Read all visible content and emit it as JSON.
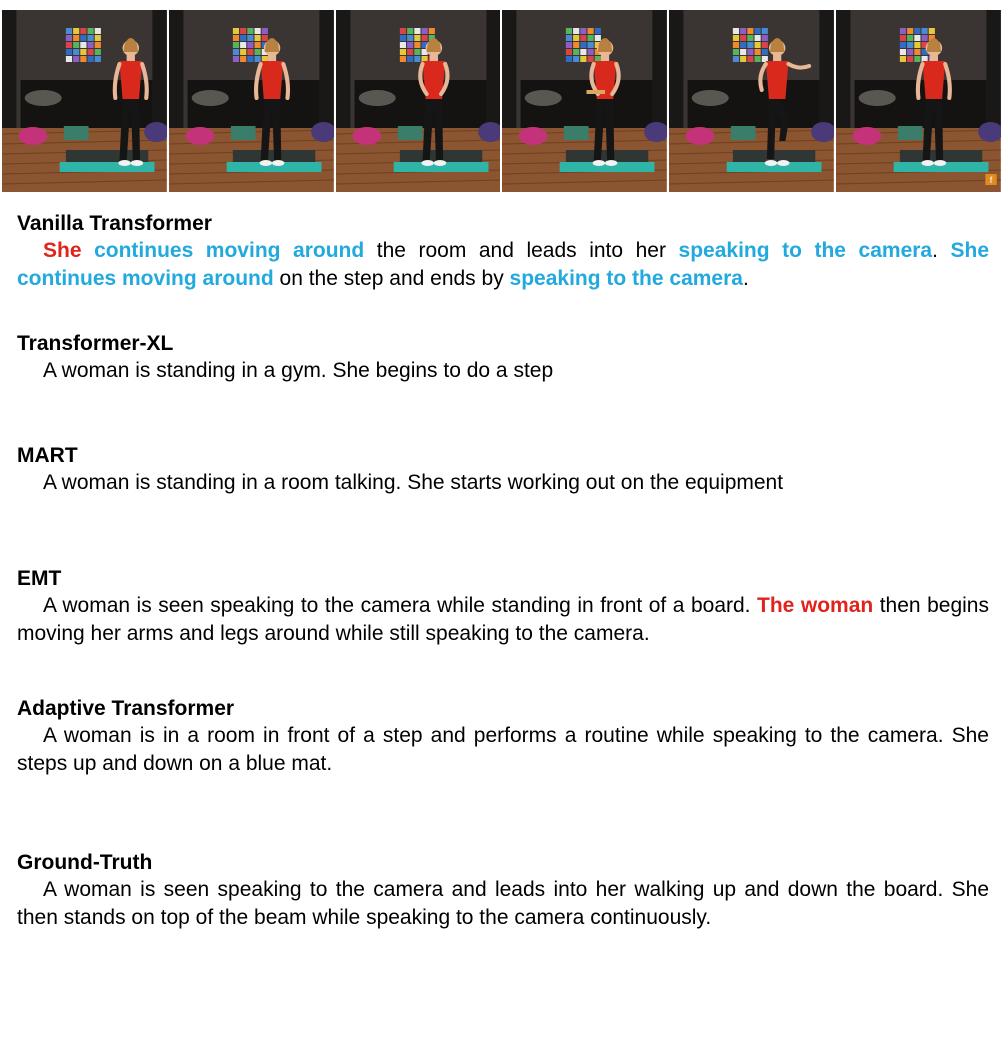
{
  "colors": {
    "error_red": "#e0241b",
    "repeat_blue": "#22a9dd"
  },
  "figure": {
    "frames": [
      {
        "pose": "arms-down"
      },
      {
        "pose": "arms-down"
      },
      {
        "pose": "hands-front"
      },
      {
        "pose": "holding-object"
      },
      {
        "pose": "knee-raised"
      },
      {
        "pose": "arms-down"
      }
    ],
    "watermark": "f"
  },
  "methods": [
    {
      "name": "Vanilla Transformer",
      "segments": [
        {
          "text": "She",
          "style": "red"
        },
        {
          "text": " ",
          "style": "plain"
        },
        {
          "text": "continues moving around",
          "style": "blue"
        },
        {
          "text": " the room and leads into her ",
          "style": "plain"
        },
        {
          "text": "speaking to the camera",
          "style": "blue"
        },
        {
          "text": ". ",
          "style": "plain"
        },
        {
          "text": "She continues moving around",
          "style": "blue"
        },
        {
          "text": " on the step and ends by ",
          "style": "plain"
        },
        {
          "text": "speaking to the camera",
          "style": "blue"
        },
        {
          "text": ".",
          "style": "plain"
        }
      ]
    },
    {
      "name": "Transformer-XL",
      "segments": [
        {
          "text": "A woman is standing in a gym. She begins to do a step",
          "style": "plain"
        }
      ]
    },
    {
      "name": "MART",
      "segments": [
        {
          "text": "A woman is standing in a room talking. She starts working out on the equipment",
          "style": "plain"
        }
      ]
    },
    {
      "name": "EMT",
      "segments": [
        {
          "text": "A woman is seen speaking to the camera while standing in front of a board. ",
          "style": "plain"
        },
        {
          "text": "The woman",
          "style": "red"
        },
        {
          "text": " then begins moving her arms and legs around while still speaking to the camera.",
          "style": "plain"
        }
      ]
    },
    {
      "name": "Adaptive Transformer",
      "segments": [
        {
          "text": "A woman is in a room in front of a step and performs a routine while speaking to the camera. She steps up and down on a blue mat.",
          "style": "plain"
        }
      ]
    },
    {
      "name": "Ground-Truth",
      "segments": [
        {
          "text": "A woman is seen speaking to the camera and leads into her walking up and down the board. She then stands on top of the beam while speaking to the camera continuously.",
          "style": "plain"
        }
      ]
    }
  ]
}
